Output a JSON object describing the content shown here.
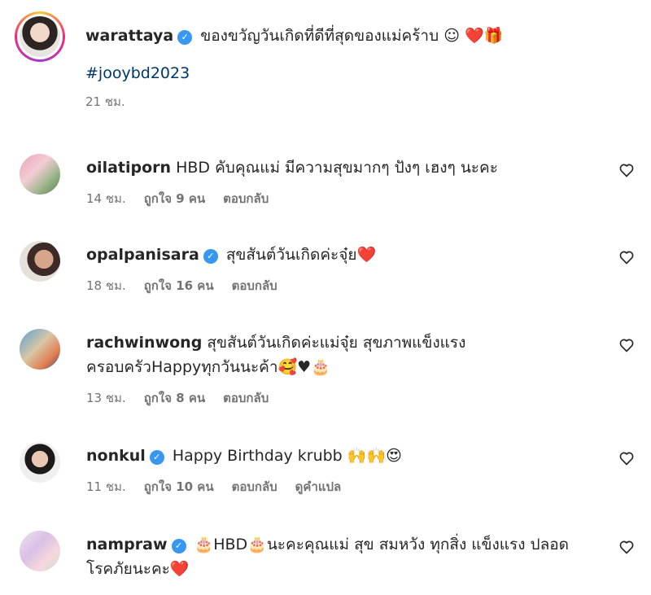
{
  "caption": {
    "username": "warattaya",
    "text": "ของขวัญวันเกิดที่ดีที่สุดของแม่คร้าบ ☺",
    "emojis": "❤️🎁",
    "hashtag": "#jooybd2023",
    "time": "21 ชม."
  },
  "comments": [
    {
      "username": "oilatiporn",
      "verified": false,
      "text": "HBD คับคุณแม่ มีความสุขมากๆ ปังๆ เฮงๆ นะคะ",
      "time": "14 ชม.",
      "likes": "ถูกใจ 9 คน",
      "reply": "ตอบกลับ"
    },
    {
      "username": "opalpanisara",
      "verified": true,
      "text": "สุขสันต์วันเกิดค่ะจุ๋ย❤️",
      "time": "18 ชม.",
      "likes": "ถูกใจ 16 คน",
      "reply": "ตอบกลับ"
    },
    {
      "username": "rachwinwong",
      "verified": false,
      "text": "สุขสันต์วันเกิดค่ะแม่จุ๋ย สุขภาพแข็งแรง ครอบครัวHappyทุกวันนะค้า🥰♥🎂",
      "time": "13 ชม.",
      "likes": "ถูกใจ 8 คน",
      "reply": "ตอบกลับ"
    },
    {
      "username": "nonkul",
      "verified": true,
      "text": "Happy Birthday krubb 🙌🙌😍",
      "time": "11 ชม.",
      "likes": "ถูกใจ 10 คน",
      "reply": "ตอบกลับ",
      "translate": "ดูคำแปล"
    },
    {
      "username": "nampraw",
      "verified": true,
      "text": "🎂HBD🎂นะคะคุณแม่ สุข สมหวัง ทุกสิ่ง แข็งแรง ปลอดโรคภัยนะคะ❤️"
    }
  ],
  "icons": {
    "verified": "verified-badge-icon",
    "like": "heart-outline-icon"
  },
  "colors": {
    "verified": "#3897f0",
    "hashtag": "#00376b",
    "meta": "#737373"
  }
}
